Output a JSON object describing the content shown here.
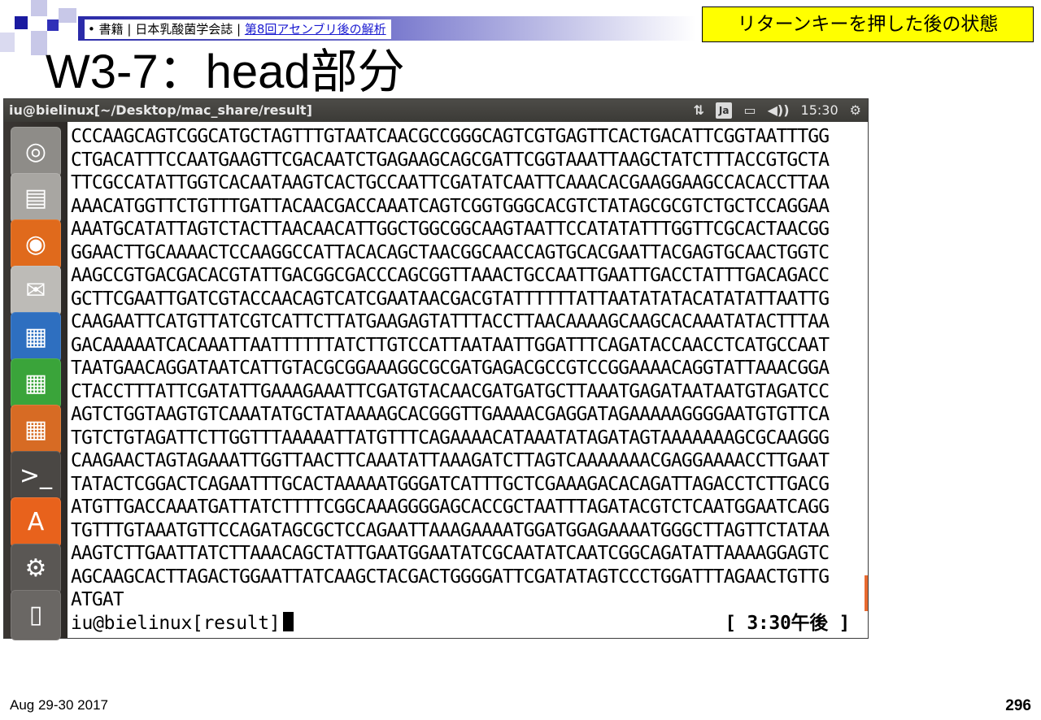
{
  "slide": {
    "breadcrumb_bullet": "•",
    "breadcrumb_text": "書籍 | 日本乳酸菌学会誌 |",
    "breadcrumb_link": "第8回アセンブリ後の解析",
    "status_note": "リターンキーを押した後の状態",
    "title": "W3-7：head部分",
    "footer_date": "Aug 29-30 2017",
    "page_number": "296"
  },
  "window": {
    "title": "iu@bielinux[~/Desktop/mac_share/result]",
    "tray": {
      "network_glyph": "⇅",
      "keyboard_layout": "Ja",
      "battery_glyph": "▭",
      "volume_glyph": "◀))",
      "clock": "15:30",
      "settings_glyph": "⚙"
    }
  },
  "launcher": {
    "items": [
      {
        "name": "dash",
        "glyph": "◎",
        "bg": "#8e8c88"
      },
      {
        "name": "files",
        "glyph": "▤",
        "bg": "#a8a6a2"
      },
      {
        "name": "firefox",
        "glyph": "◉",
        "bg": "#e06a1c"
      },
      {
        "name": "mail",
        "glyph": "✉",
        "bg": "#bdbbb7"
      },
      {
        "name": "writer",
        "glyph": "▦",
        "bg": "#2e6fc0"
      },
      {
        "name": "calc",
        "glyph": "▦",
        "bg": "#3aa43a"
      },
      {
        "name": "impress",
        "glyph": "▦",
        "bg": "#d76b24"
      },
      {
        "name": "terminal",
        "glyph": ">_",
        "bg": "#4a4744"
      },
      {
        "name": "software",
        "glyph": "A",
        "bg": "#e8621c"
      },
      {
        "name": "settings",
        "glyph": "⚙",
        "bg": "#5a5754"
      },
      {
        "name": "trash",
        "glyph": "▯",
        "bg": "#6a6764"
      }
    ]
  },
  "terminal": {
    "lines": [
      "CCCAAGCAGTCGGCATGCTAGTTTGTAATCAACGCCGGGCAGTCGTGAGTTCACTGACATTCGGTAATTTGG",
      "CTGACATTTCCAATGAAGTTCGACAATCTGAGAAGCAGCGATTCGGTAAATTAAGCTATCTTTACCGTGCTA",
      "TTCGCCATATTGGTCACAATAAGTCACTGCCAATTCGATATCAATTCAAACACGAAGGAAGCCACACCTTAA",
      "AAACATGGTTCTGTTTGATTACAACGACCAAATCAGTCGGTGGGCACGTCTATAGCGCGTCTGCTCCAGGAA",
      "AAATGCATATTAGTCTACTTAACAACATTGGCTGGCGGCAAGTAATTCCATATATTTGGTTCGCACTAACGG",
      "GGAACTTGCAAAACTCCAAGGCCATTACACAGCTAACGGCAACCAGTGCACGAATTACGAGTGCAACTGGTC",
      "AAGCCGTGACGACACGTATTGACGGCGACCCAGCGGTTAAACTGCCAATTGAATTGACCTATTTGACAGACC",
      "GCTTCGAATTGATCGTACCAACAGTCATCGAATAACGACGTATTTTTTATTAATATATACATATATTAATTG",
      "CAAGAATTCATGTTATCGTCATTCTTATGAAGAGTATTTACCTTAACAAAAGCAAGCACAAATATACTTTAA",
      "GACAAAAATCACAAATTAATTTTTTATCTTGTCCATTAATAATTGGATTTCAGATACCAACCTCATGCCAAT",
      "TAATGAACAGGATAATCATTGTACGCGGAAAGGCGCGATGAGACGCCGTCCGGAAAACAGGTATTAAACGGA",
      "CTACCTTTATTCGATATTGAAAGAAATTCGATGTACAACGATGATGCTTAAATGAGATAATAATGTAGATCC",
      "AGTCTGGTAAGTGTCAAATATGCTATAAAAGCACGGGTTGAAAACGAGGATAGAAAAAGGGGAATGTGTTCA",
      "TGTCTGTAGATTCTTGGTTTAAAAATTATGTTTCAGAAAACATAAATATAGATAGTAAAAAAAGCGCAAGGG",
      "CAAGAACTAGTAGAAATTGGTTAACTTCAAATATTAAAGATCTTAGTCAAAAAAACGAGGAAAACCTTGAAT",
      "TATACTCGGACTCAGAATTTGCACTAAAAATGGGATCATTTGCTCGAAAGACACAGATTAGACCTCTTGACG",
      "ATGTTGACCAAATGATTATCTTTTCGGCAAAGGGGAGCACCGCTAATTTAGATACGTCTCAATGGAATCAGG",
      "TGTTTGTAAATGTTCCAGATAGCGCTCCAGAATTAAAGAAAATGGATGGAGAAAATGGGCTTAGTTCTATAA",
      "AAGTCTTGAATTATCTTAAACAGCTATTGAATGGAATATCGCAATATCAATCGGCAGATATTAAAAGGAGTC",
      "AGCAAGCACTTAGACTGGAATTATCAAGCTACGACTGGGGATTCGATATAGTCCCTGGATTTAGAACTGTTG",
      "ATGAT"
    ],
    "prompt": "iu@bielinux[result]",
    "right_prompt": "[ 3:30午後 ]"
  }
}
